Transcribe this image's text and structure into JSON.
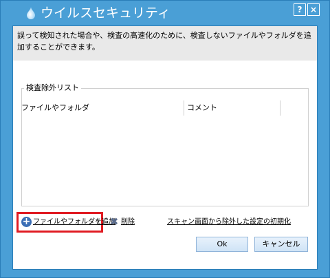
{
  "window": {
    "title": "ウイルスセキュリティ",
    "help_label": "?",
    "close_label": "×"
  },
  "description": "誤って検知された場合や、検査の高速化のために、検査しないファイルやフォルダを追加することができます。",
  "exclusion_group": {
    "label": "検査除外リスト",
    "columns": [
      "ファイルやフォルダ",
      "コメント"
    ],
    "rows": []
  },
  "actions": {
    "add_label": "ファイルやフォルダを追加",
    "delete_label": "削除",
    "reset_label": "スキャン画面から除外した設定の初期化"
  },
  "buttons": {
    "ok": "Ok",
    "cancel": "キャンセル"
  },
  "colors": {
    "frame": "#4a9fd6",
    "highlight": "#e01b22",
    "add_icon": "#3b6eb5"
  },
  "icons": {
    "app": "water-drop-icon",
    "add": "plus-circle-icon",
    "delete": "x-mark-icon"
  }
}
